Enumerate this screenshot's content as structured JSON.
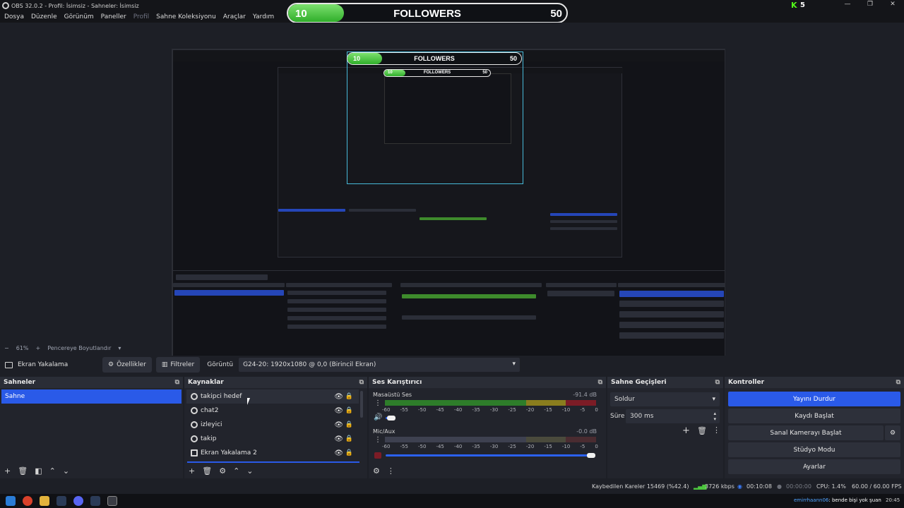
{
  "window": {
    "title": "OBS 32.0.2 - Profil: İsimsiz - Sahneler: İsimsiz",
    "kick_icon": "kick-logo-icon",
    "kick_viewer_count": "5",
    "minimize": "—",
    "maximize": "❐",
    "close": "✕"
  },
  "followers_overlay": {
    "current": "10",
    "label": "FOLLOWERS",
    "target": "50",
    "progress_fraction": 0.2,
    "color_fill": "#4dc63f"
  },
  "menu": {
    "items": [
      "Dosya",
      "Düzenle",
      "Görünüm",
      "Paneller",
      "Profil",
      "Sahne Koleksiyonu",
      "Araçlar",
      "Yardım"
    ]
  },
  "zoom": {
    "value": "61%",
    "mode": "Pencereye Boyutlandır"
  },
  "source_toolbar": {
    "source_name": "Ekran Yakalama",
    "properties": "Özellikler",
    "filters": "Filtreler",
    "display_label": "Görüntü",
    "display_value": "G24-20: 1920x1080 @ 0,0 (Birincil Ekran)"
  },
  "scenes": {
    "title": "Sahneler",
    "items": [
      "Sahne"
    ]
  },
  "sources": {
    "title": "Kaynaklar",
    "items": [
      "takipci hedef",
      "chat2",
      "izleyici",
      "takip",
      "Ekran Yakalama 2"
    ]
  },
  "mixer": {
    "title": "Ses Karıştırıcı",
    "channels": [
      {
        "name": "Masaüstü Ses",
        "db": "-91.4 dB"
      },
      {
        "name": "Mic/Aux",
        "db": "-0.0 dB"
      }
    ],
    "scale": [
      "-60",
      "-55",
      "-50",
      "-45",
      "-40",
      "-35",
      "-30",
      "-25",
      "-20",
      "-15",
      "-10",
      "-5",
      "0"
    ]
  },
  "transitions": {
    "title": "Sahne Geçişleri",
    "selected": "Soldur",
    "duration_label": "Süre",
    "duration_value": "300 ms"
  },
  "controls": {
    "title": "Kontroller",
    "stop_stream": "Yayını Durdur",
    "start_recording": "Kaydı Başlat",
    "virtual_camera": "Sanal Kamerayı Başlat",
    "studio_mode": "Stüdyo Modu",
    "settings": "Ayarlar"
  },
  "status": {
    "dropped_frames": "Kaybedilen Kareler 15469 (%42.4)",
    "bitrate": "3726 kbps",
    "stream_time": "00:10:08",
    "record_time": "00:00:00",
    "cpu": "CPU: 1.4%",
    "fps": "60.00 / 60.00 FPS"
  },
  "taskbar": {
    "chat_user": "emirrhaann06",
    "chat_message": ": bende bişi yok şuan",
    "clock": "20:45"
  },
  "colors": {
    "accent": "#2a5ae8",
    "panel": "#22242c",
    "background": "#1d1f26",
    "meter_green": "#2e7d2a",
    "meter_yellow": "#8a7d1e",
    "meter_red": "#7c1c26"
  }
}
